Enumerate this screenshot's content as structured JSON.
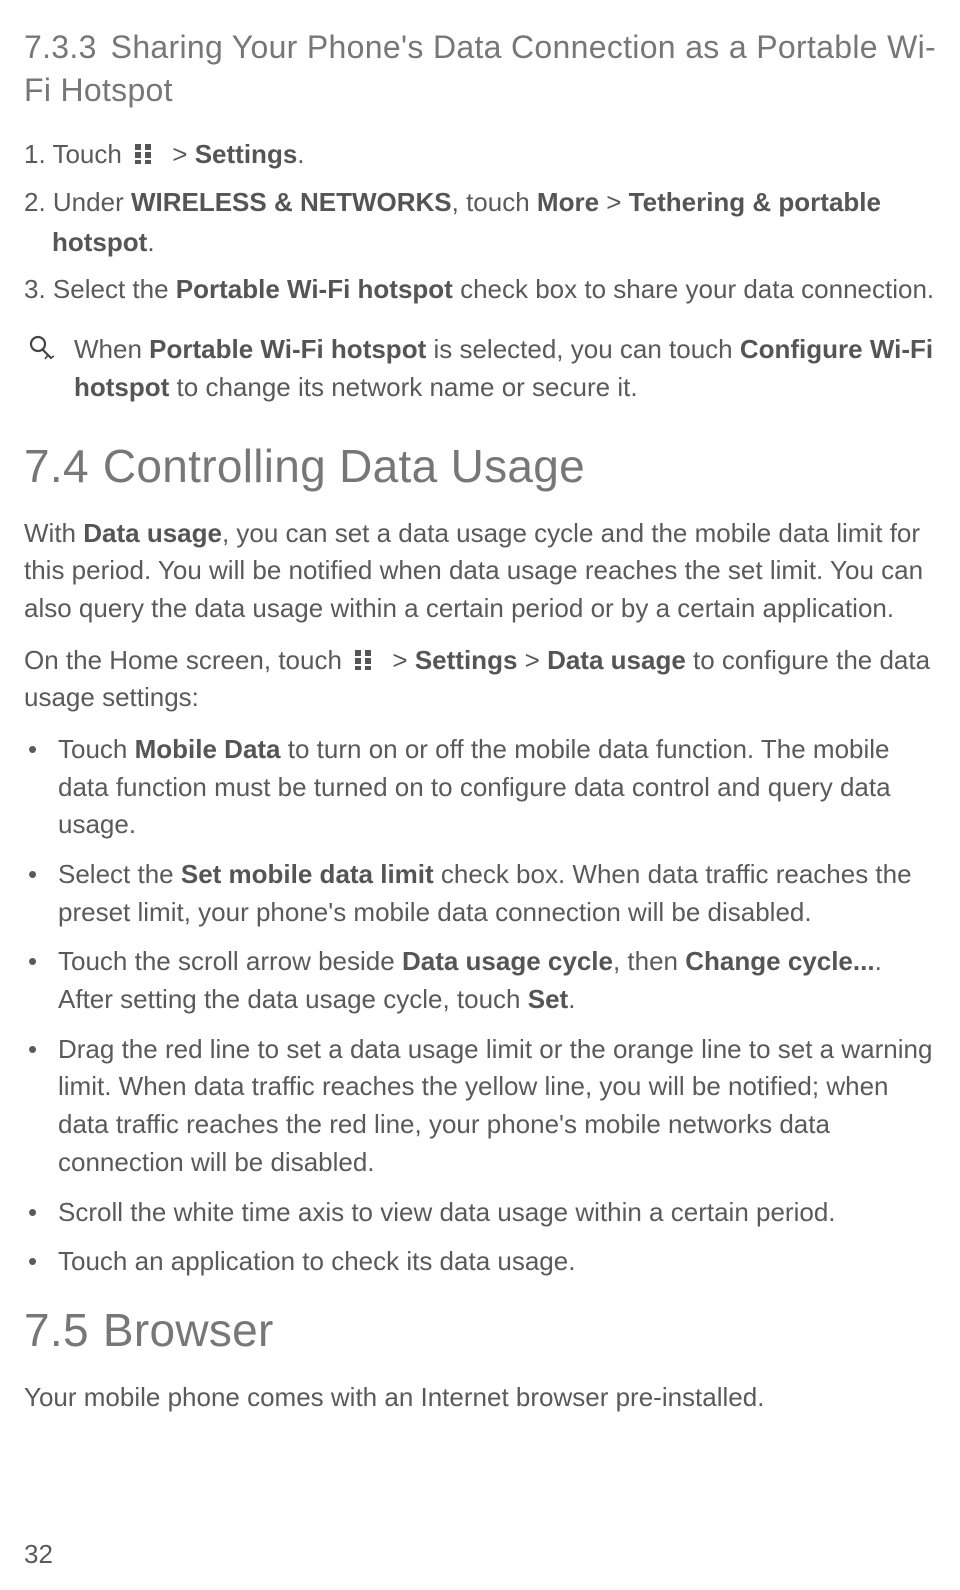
{
  "section733": {
    "number": "7.3.3",
    "title": "Sharing Your Phone's Data Connection as a Portable Wi-Fi Hotspot",
    "step1_a": "1. Touch",
    "step1_b": "> ",
    "step1_bold": "Settings",
    "step1_c": ".",
    "step2_a": "2. Under ",
    "step2_bold1": "WIRELESS & NETWORKS",
    "step2_b": ", touch ",
    "step2_bold2": "More",
    "step2_c": " > ",
    "step2_bold3": "Tethering & portable",
    "step2_indent_bold": "hotspot",
    "step2_indent_end": ".",
    "step3_a": "3. Select the ",
    "step3_bold": "Portable Wi-Fi hotspot",
    "step3_b": " check box to share your data connection.",
    "note_a": "When ",
    "note_bold1": "Portable Wi-Fi hotspot",
    "note_b": " is selected, you can touch ",
    "note_bold2": "Configure Wi-Fi hotspot",
    "note_c": " to change its network name or secure it."
  },
  "section74": {
    "number": "7.4",
    "title": "Controlling Data Usage",
    "p1_a": "With ",
    "p1_bold": "Data usage",
    "p1_b": ", you can set a data usage cycle and the mobile data limit for this period. You will be notified when data usage reaches the set limit. You can also query the data usage within a certain period or by a certain application.",
    "p2_a": "On the Home screen, touch",
    "p2_b": "> ",
    "p2_bold1": "Settings",
    "p2_c": " > ",
    "p2_bold2": "Data usage",
    "p2_d": " to configure the data usage settings:",
    "b1_a": "Touch ",
    "b1_bold": "Mobile Data",
    "b1_b": " to turn on or off the mobile data function. The mobile data function must be turned on to configure data control and query data usage.",
    "b2_a": "Select the ",
    "b2_bold": "Set mobile data limit",
    "b2_b": " check box. When data traffic reaches the preset limit, your phone's mobile data connection will be disabled.",
    "b3_a": "Touch the scroll arrow beside ",
    "b3_bold1": "Data usage cycle",
    "b3_b": ", then ",
    "b3_bold2": "Change cycle...",
    "b3_c": ". After setting the data usage cycle, touch ",
    "b3_bold3": "Set",
    "b3_d": ".",
    "b4": "Drag the red line to set a data usage limit or the orange line to set a warning limit. When data traffic reaches the yellow line, you will be notified; when data traffic reaches the red line, your phone's mobile networks data connection will be disabled.",
    "b5": "Scroll the white time axis to view data usage within a certain period.",
    "b6": "Touch an application to check its data usage."
  },
  "section75": {
    "number": "7.5",
    "title": "Browser",
    "p1": "Your mobile phone comes with an Internet browser pre-installed."
  },
  "pageNum": "32",
  "bulletChar": "•"
}
